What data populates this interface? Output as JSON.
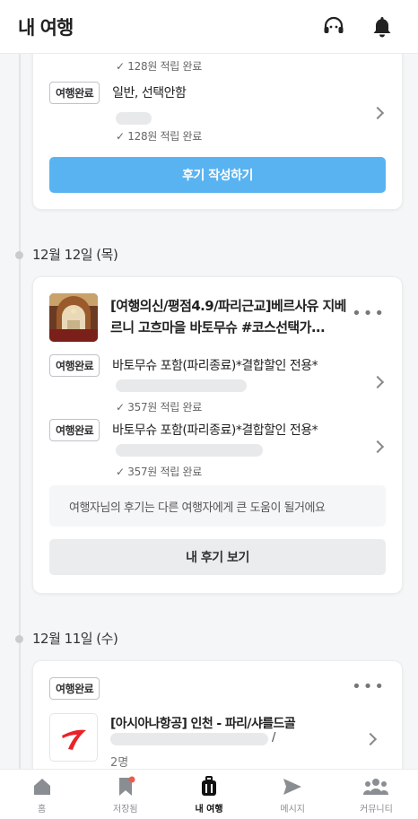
{
  "header": {
    "title": "내 여행"
  },
  "card1": {
    "top_point": "128원 적립 완료",
    "badge": "여행완료",
    "option": "일반, 선택안함",
    "point": "128원 적립 완료",
    "button": "후기 작성하기"
  },
  "date1": "12월 12일 (목)",
  "card2": {
    "title": "[여행의신/평점4.9/파리근교]베르사유 지베르니 고흐마을 바토무슈 #코스선택가...",
    "items": [
      {
        "badge": "여행완료",
        "option": "바토무슈 포함(파리종료)*결합할인 전용*",
        "point": "357원 적립 완료"
      },
      {
        "badge": "여행완료",
        "option": "바토무슈 포함(파리종료)*결합할인 전용*",
        "point": "357원 적립 완료"
      }
    ],
    "notice": "여행자님의 후기는 다른 여행자에게 큰 도움이 될거에요",
    "button": "내 후기 보기"
  },
  "date2": "12월 11일 (수)",
  "card3": {
    "badge": "여행완료",
    "title": "[아시아나항공] 인천 - 파리/샤를드골",
    "slash": "/",
    "people": "2명"
  },
  "tabs": [
    {
      "label": "홈",
      "icon": "home-icon"
    },
    {
      "label": "저장됨",
      "icon": "bookmark-icon"
    },
    {
      "label": "내 여행",
      "icon": "suitcase-icon"
    },
    {
      "label": "메시지",
      "icon": "send-icon"
    },
    {
      "label": "커뮤니티",
      "icon": "people-icon"
    }
  ],
  "colors": {
    "accent": "#5ab3f1",
    "notify_dot": "#f15a4a",
    "airline_red": "#e8242b"
  }
}
